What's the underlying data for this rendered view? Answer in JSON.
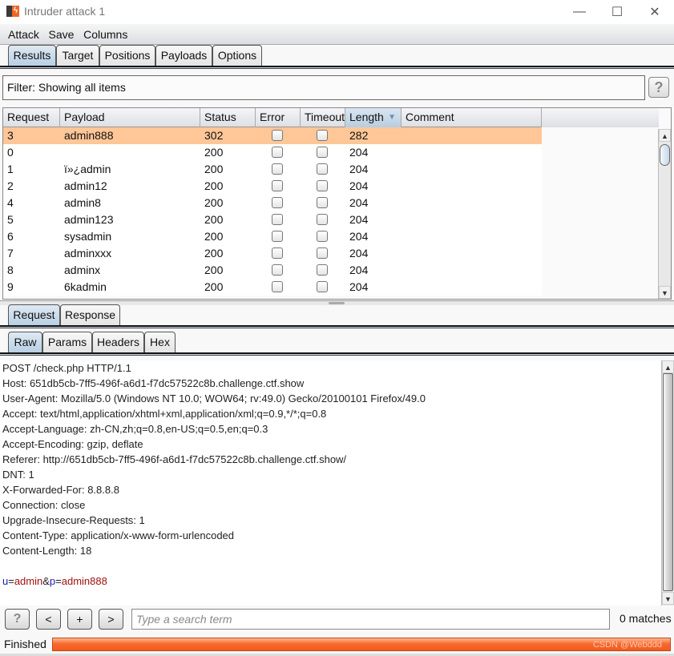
{
  "window": {
    "title": "Intruder attack 1",
    "icon": "burp-suite-icon",
    "controls": {
      "minimize": "—",
      "maximize": "☐",
      "close": "✕"
    }
  },
  "menubar": [
    "Attack",
    "Save",
    "Columns"
  ],
  "main_tabs": {
    "items": [
      "Results",
      "Target",
      "Positions",
      "Payloads",
      "Options"
    ],
    "active": "Results"
  },
  "filter": {
    "text": "Filter: Showing all items",
    "help_label": "?"
  },
  "results_table": {
    "columns": [
      "Request",
      "Payload",
      "Status",
      "Error",
      "Timeout",
      "Length",
      "Comment"
    ],
    "sorted_column": "Length",
    "sort_direction": "descending",
    "selected_row": 0,
    "rows": [
      {
        "request": "3",
        "payload": "admin888",
        "status": "302",
        "error": false,
        "timeout": false,
        "length": "282",
        "comment": ""
      },
      {
        "request": "0",
        "payload": "",
        "status": "200",
        "error": false,
        "timeout": false,
        "length": "204",
        "comment": ""
      },
      {
        "request": "1",
        "payload": "ï»¿admin",
        "status": "200",
        "error": false,
        "timeout": false,
        "length": "204",
        "comment": ""
      },
      {
        "request": "2",
        "payload": "admin12",
        "status": "200",
        "error": false,
        "timeout": false,
        "length": "204",
        "comment": ""
      },
      {
        "request": "4",
        "payload": "admin8",
        "status": "200",
        "error": false,
        "timeout": false,
        "length": "204",
        "comment": ""
      },
      {
        "request": "5",
        "payload": "admin123",
        "status": "200",
        "error": false,
        "timeout": false,
        "length": "204",
        "comment": ""
      },
      {
        "request": "6",
        "payload": "sysadmin",
        "status": "200",
        "error": false,
        "timeout": false,
        "length": "204",
        "comment": ""
      },
      {
        "request": "7",
        "payload": "adminxxx",
        "status": "200",
        "error": false,
        "timeout": false,
        "length": "204",
        "comment": ""
      },
      {
        "request": "8",
        "payload": "adminx",
        "status": "200",
        "error": false,
        "timeout": false,
        "length": "204",
        "comment": ""
      },
      {
        "request": "9",
        "payload": "6kadmin",
        "status": "200",
        "error": false,
        "timeout": false,
        "length": "204",
        "comment": ""
      }
    ]
  },
  "message_tabs": {
    "items": [
      "Request",
      "Response"
    ],
    "active": "Request"
  },
  "view_tabs": {
    "items": [
      "Raw",
      "Params",
      "Headers",
      "Hex"
    ],
    "active": "Raw"
  },
  "request": {
    "lines": [
      "POST /check.php HTTP/1.1",
      "Host: 651db5cb-7ff5-496f-a6d1-f7dc57522c8b.challenge.ctf.show",
      "User-Agent: Mozilla/5.0 (Windows NT 10.0; WOW64; rv:49.0) Gecko/20100101 Firefox/49.0",
      "Accept: text/html,application/xhtml+xml,application/xml;q=0.9,*/*;q=0.8",
      "Accept-Language: zh-CN,zh;q=0.8,en-US;q=0.5,en;q=0.3",
      "Accept-Encoding: gzip, deflate",
      "Referer: http://651db5cb-7ff5-496f-a6d1-f7dc57522c8b.challenge.ctf.show/",
      "DNT: 1",
      "X-Forwarded-For: 8.8.8.8",
      "Connection: close",
      "Upgrade-Insecure-Requests: 1",
      "Content-Type: application/x-www-form-urlencoded",
      "Content-Length: 18",
      ""
    ],
    "body": {
      "param1_name": "u",
      "eq1": "=",
      "param1_value": "admin",
      "amp": "&",
      "param2_name": "p",
      "eq2": "=",
      "param2_value": "admin888"
    },
    "colors": {
      "param_name": "#1a1ab0",
      "param_value": "#a01010"
    }
  },
  "search": {
    "help_label": "?",
    "prev_label": "<",
    "add_label": "+",
    "next_label": ">",
    "placeholder": "Type a search term",
    "value": "",
    "matches": "0 matches"
  },
  "status": {
    "label": "Finished",
    "progress_percent": 100,
    "color": "#f25a1c"
  },
  "watermark": "CSDN @Webddd"
}
